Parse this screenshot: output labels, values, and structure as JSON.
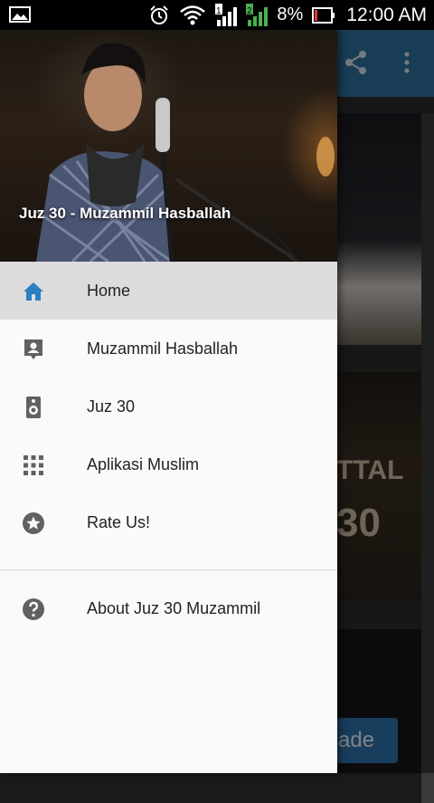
{
  "status_bar": {
    "battery": "8%",
    "time": "12:00 AM",
    "icons": [
      "image-icon",
      "alarm-icon",
      "wifi-icon",
      "signal-icon-1",
      "signal-icon-2",
      "battery-icon"
    ]
  },
  "background_app": {
    "card_text_1": "TTAL",
    "card_text_2": "30",
    "button_label": "ade",
    "toolbar_icons": [
      "share-icon",
      "more-vert-icon"
    ]
  },
  "drawer": {
    "header_title": "Juz 30 - Muzammil Hasballah",
    "items": [
      {
        "label": "Home",
        "icon": "home-icon",
        "active": true
      },
      {
        "label": "Muzammil Hasballah",
        "icon": "contact-icon"
      },
      {
        "label": "Juz 30",
        "icon": "speaker-icon"
      },
      {
        "label": "Aplikasi Muslim",
        "icon": "apps-grid-icon"
      },
      {
        "label": "Rate Us!",
        "icon": "star-icon"
      }
    ],
    "footer_items": [
      {
        "label": "About Juz 30 Muzammil",
        "icon": "help-icon"
      }
    ]
  },
  "colors": {
    "accent": "#2d7fc1",
    "icon_gray": "#616161",
    "toolbar": "#2f6f99"
  }
}
